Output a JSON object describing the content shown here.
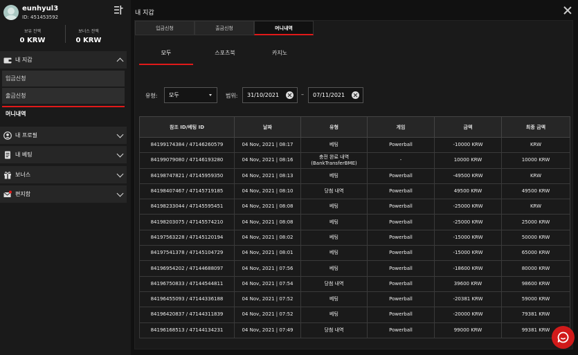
{
  "user": {
    "name": "eunhyul3",
    "id": "ID: 451453592"
  },
  "balances": [
    {
      "label": "보유 잔액",
      "value": "0 KRW"
    },
    {
      "label": "보너스 잔액",
      "value": "0 KRW"
    }
  ],
  "sidebar": {
    "wallet": "내 지갑",
    "wallet_items": [
      "입금신청",
      "출금신청",
      "머니내역"
    ],
    "profile": "내 프로필",
    "bets": "내 베팅",
    "bonus": "보너스",
    "inbox": "편지함"
  },
  "modal": {
    "title": "내 지갑",
    "top_tabs": [
      "입금신청",
      "출금신청",
      "머니내역"
    ],
    "active_top_tab": "머니내역",
    "sub_tabs": [
      "모두",
      "스포츠북",
      "카지노"
    ],
    "active_sub_tab": "모두"
  },
  "filters": {
    "type_label": "유형:",
    "type_value": "모두",
    "range_label": "범위:",
    "date_from": "31/10/2021",
    "date_sep": "–",
    "date_to": "07/11/2021"
  },
  "table": {
    "headers": [
      "참조 ID/베팅 ID",
      "날짜",
      "유형",
      "게임",
      "금액",
      "최종 금액"
    ],
    "rows": [
      [
        "84199174384 / 47146260579",
        "04 Nov, 2021 | 08:17",
        "베팅",
        "Powerball",
        "-10000 KRW",
        "KRW"
      ],
      [
        "84199079080 / 47146193280",
        "04 Nov, 2021 | 08:16",
        "충전 완료 내역\n(BankTransferBME)",
        "-",
        "10000 KRW",
        "10000 KRW"
      ],
      [
        "84198747821 / 47145959350",
        "04 Nov, 2021 | 08:13",
        "베팅",
        "Powerball",
        "-49500 KRW",
        "KRW"
      ],
      [
        "84198407467 / 47145719185",
        "04 Nov, 2021 | 08:10",
        "당첨 내역",
        "Powerball",
        "49500 KRW",
        "49500 KRW"
      ],
      [
        "84198233044 / 47145595451",
        "04 Nov, 2021 | 08:08",
        "베팅",
        "Powerball",
        "-25000 KRW",
        "KRW"
      ],
      [
        "84198203075 / 47145574210",
        "04 Nov, 2021 | 08:08",
        "베팅",
        "Powerball",
        "-25000 KRW",
        "25000 KRW"
      ],
      [
        "84197563228 / 47145120194",
        "04 Nov, 2021 | 08:02",
        "베팅",
        "Powerball",
        "-15000 KRW",
        "50000 KRW"
      ],
      [
        "84197541378 / 47145104729",
        "04 Nov, 2021 | 08:01",
        "베팅",
        "Powerball",
        "-15000 KRW",
        "65000 KRW"
      ],
      [
        "84196954202 / 47144688097",
        "04 Nov, 2021 | 07:56",
        "베팅",
        "Powerball",
        "-18600 KRW",
        "80000 KRW"
      ],
      [
        "84196750833 / 47144544811",
        "04 Nov, 2021 | 07:54",
        "당첨 내역",
        "Powerball",
        "39600 KRW",
        "98600 KRW"
      ],
      [
        "84196455093 / 47144336188",
        "04 Nov, 2021 | 07:52",
        "베팅",
        "Powerball",
        "-20381 KRW",
        "59000 KRW"
      ],
      [
        "84196420837 / 47144311839",
        "04 Nov, 2021 | 07:52",
        "베팅",
        "Powerball",
        "-20000 KRW",
        "79381 KRW"
      ],
      [
        "84196168513 / 47144134231",
        "04 Nov, 2021 | 07:49",
        "당첨 내역",
        "Powerball",
        "99000 KRW",
        "99381 KRW"
      ]
    ]
  },
  "colors": {
    "accent": "#e11919",
    "background": "#141414",
    "panel": "#1a1a1a"
  }
}
